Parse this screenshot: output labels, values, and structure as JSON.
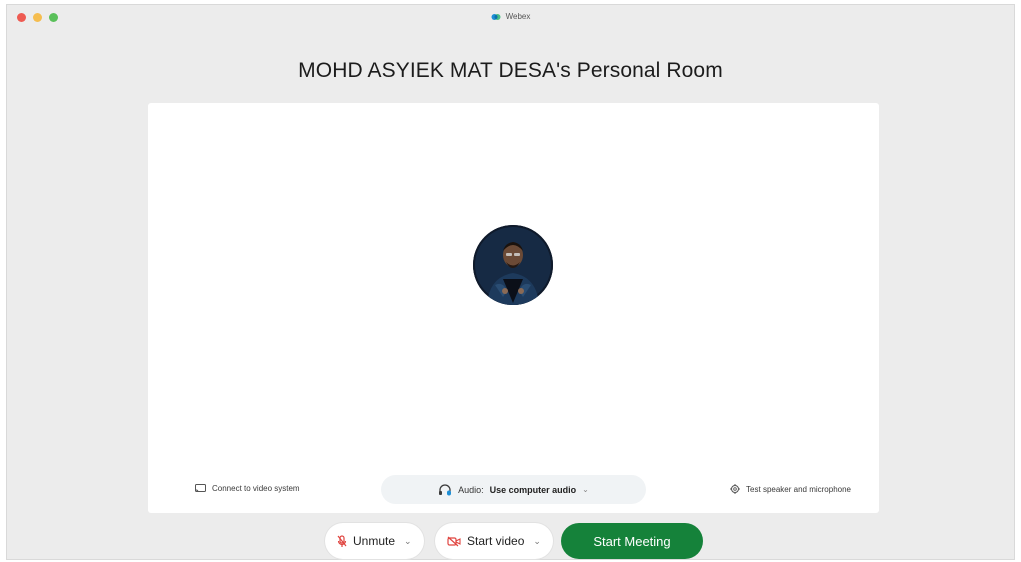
{
  "window": {
    "app_title": "Webex",
    "traffic_colors": {
      "close": "#ee5b52",
      "minimize": "#f5bd4f",
      "zoom": "#5ac05a"
    }
  },
  "room": {
    "title": "MOHD ASYIEK MAT DESA's Personal Room"
  },
  "preview": {
    "connect_label": "Connect to video system",
    "audio_prefix": "Audio:",
    "audio_value": "Use computer audio",
    "test_label": "Test speaker and microphone"
  },
  "controls": {
    "unmute_label": "Unmute",
    "start_video_label": "Start video",
    "start_meeting_label": "Start Meeting",
    "accent_color": "#15823a",
    "mute_icon_color": "#e0443f"
  },
  "icons": {
    "cast": "cast-icon",
    "headset": "headset-icon",
    "settings": "gear-icon",
    "mic_muted": "mic-muted-icon",
    "video_off": "video-off-icon",
    "caret": "chevron-down-icon"
  }
}
